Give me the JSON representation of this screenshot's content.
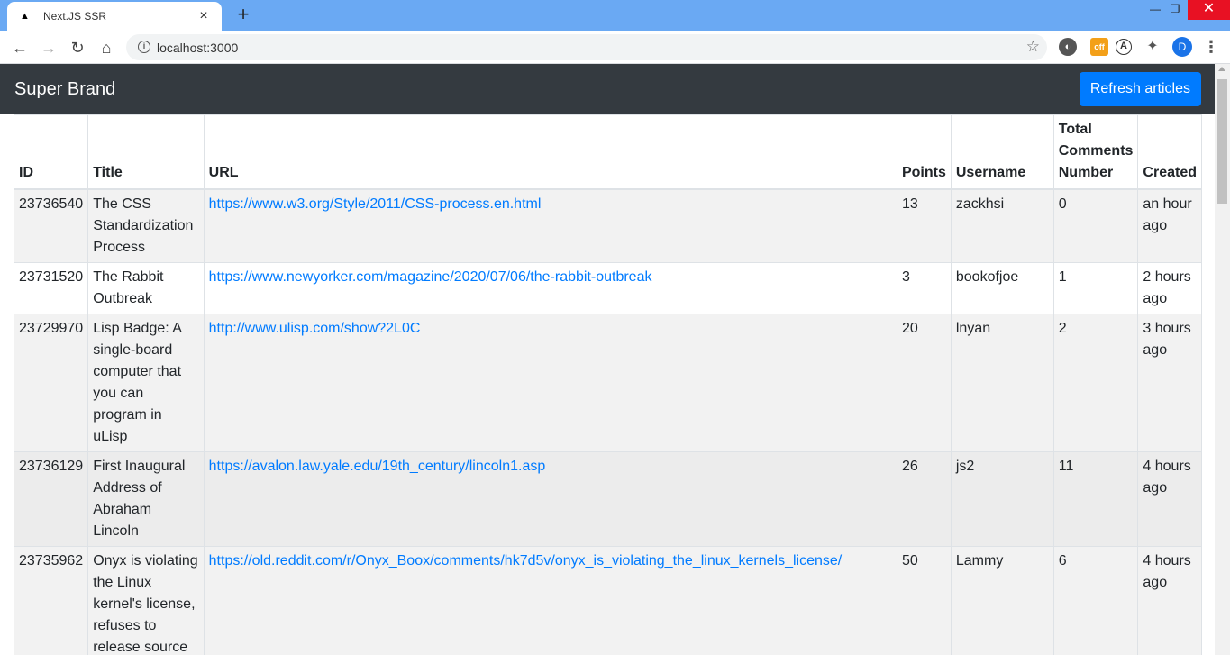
{
  "browser": {
    "tab_title": "Next.JS SSR",
    "url": "localhost:3000",
    "profile_initial": "D",
    "ext_badge": "off",
    "ext_a": "A"
  },
  "app": {
    "brand": "Super Brand",
    "refresh_label": "Refresh articles"
  },
  "table": {
    "headers": {
      "id": "ID",
      "title": "Title",
      "url": "URL",
      "points": "Points",
      "username": "Username",
      "total_comments": "Total Comments Number",
      "created": "Created"
    },
    "rows": [
      {
        "id": "23736540",
        "title": "The CSS Standardization Process",
        "url": "https://www.w3.org/Style/2011/CSS-process.en.html",
        "points": "13",
        "username": "zackhsi",
        "comments": "0",
        "created": "an hour ago"
      },
      {
        "id": "23731520",
        "title": "The Rabbit Outbreak",
        "url": "https://www.newyorker.com/magazine/2020/07/06/the-rabbit-outbreak",
        "points": "3",
        "username": "bookofjoe",
        "comments": "1",
        "created": "2 hours ago"
      },
      {
        "id": "23729970",
        "title": "Lisp Badge: A single-board computer that you can program in uLisp",
        "url": "http://www.ulisp.com/show?2L0C",
        "points": "20",
        "username": "lnyan",
        "comments": "2",
        "created": "3 hours ago"
      },
      {
        "id": "23736129",
        "title": "First Inaugural Address of Abraham Lincoln",
        "url": "https://avalon.law.yale.edu/19th_century/lincoln1.asp",
        "points": "26",
        "username": "js2",
        "comments": "11",
        "created": "4 hours ago"
      },
      {
        "id": "23735962",
        "title": "Onyx is violating the Linux kernel's license, refuses to release source",
        "url": "https://old.reddit.com/r/Onyx_Boox/comments/hk7d5v/onyx_is_violating_the_linux_kernels_license/",
        "points": "50",
        "username": "Lammy",
        "comments": "6",
        "created": "4 hours ago"
      }
    ]
  }
}
